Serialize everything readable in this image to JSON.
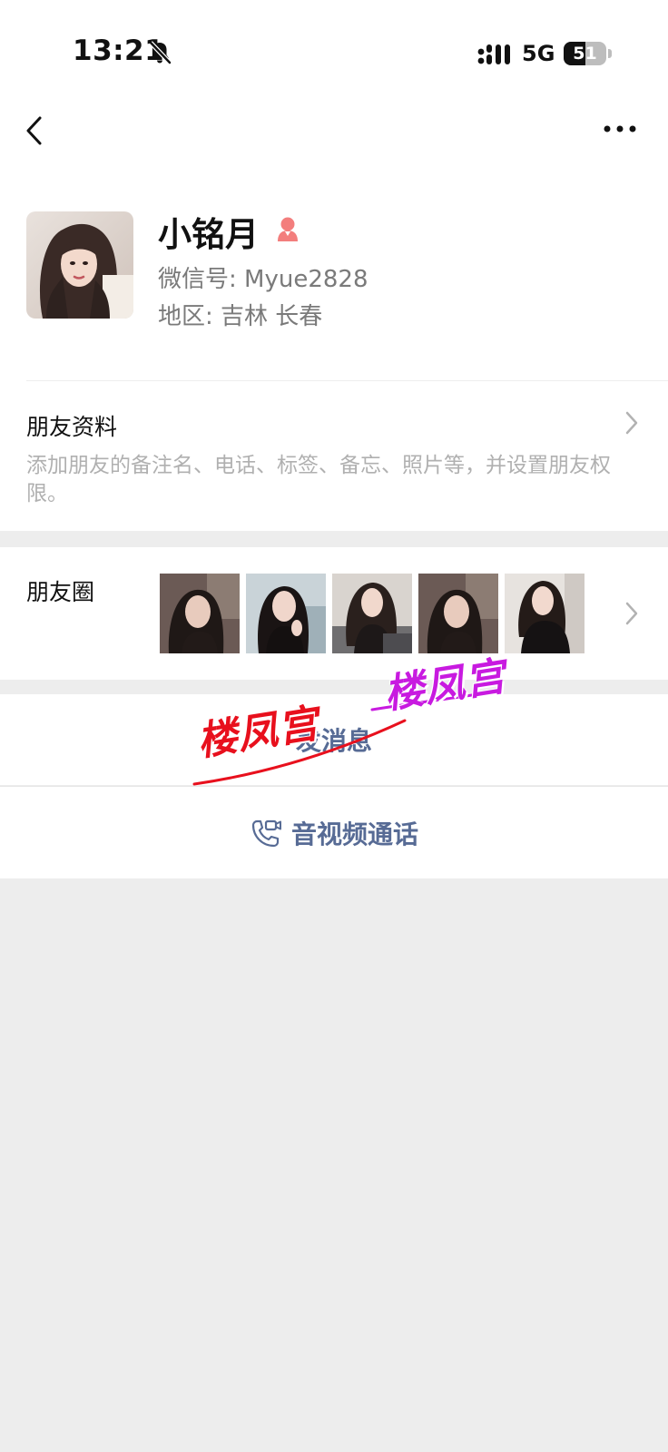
{
  "status_bar": {
    "time": "13:21",
    "network": "5G",
    "battery": "51",
    "battery_level": 0.51
  },
  "profile": {
    "name": "小铭月",
    "wechat_id": "微信号: Myue2828",
    "region": "地区: 吉林 长春",
    "gender": "female"
  },
  "friend_profile": {
    "title": "朋友资料",
    "description": "添加朋友的备注名、电话、标签、备忘、照片等，并设置朋友权限。"
  },
  "moments": {
    "title": "朋友圈",
    "thumbnail_count": 5
  },
  "actions": {
    "message": "发消息",
    "call": "音视频通话"
  },
  "watermarks": [
    "楼凤宫",
    "楼凤宫"
  ],
  "colors": {
    "accent_link": "#576b95",
    "watermark_red": "#e8101d",
    "watermark_purple": "#c81ae0",
    "gender_female": "#f37e7d"
  },
  "icons": [
    "bell-muted-icon",
    "signal-icon",
    "battery-icon",
    "back-arrow-icon",
    "more-icon",
    "female-icon",
    "chevron-right-icon",
    "video-call-icon"
  ]
}
